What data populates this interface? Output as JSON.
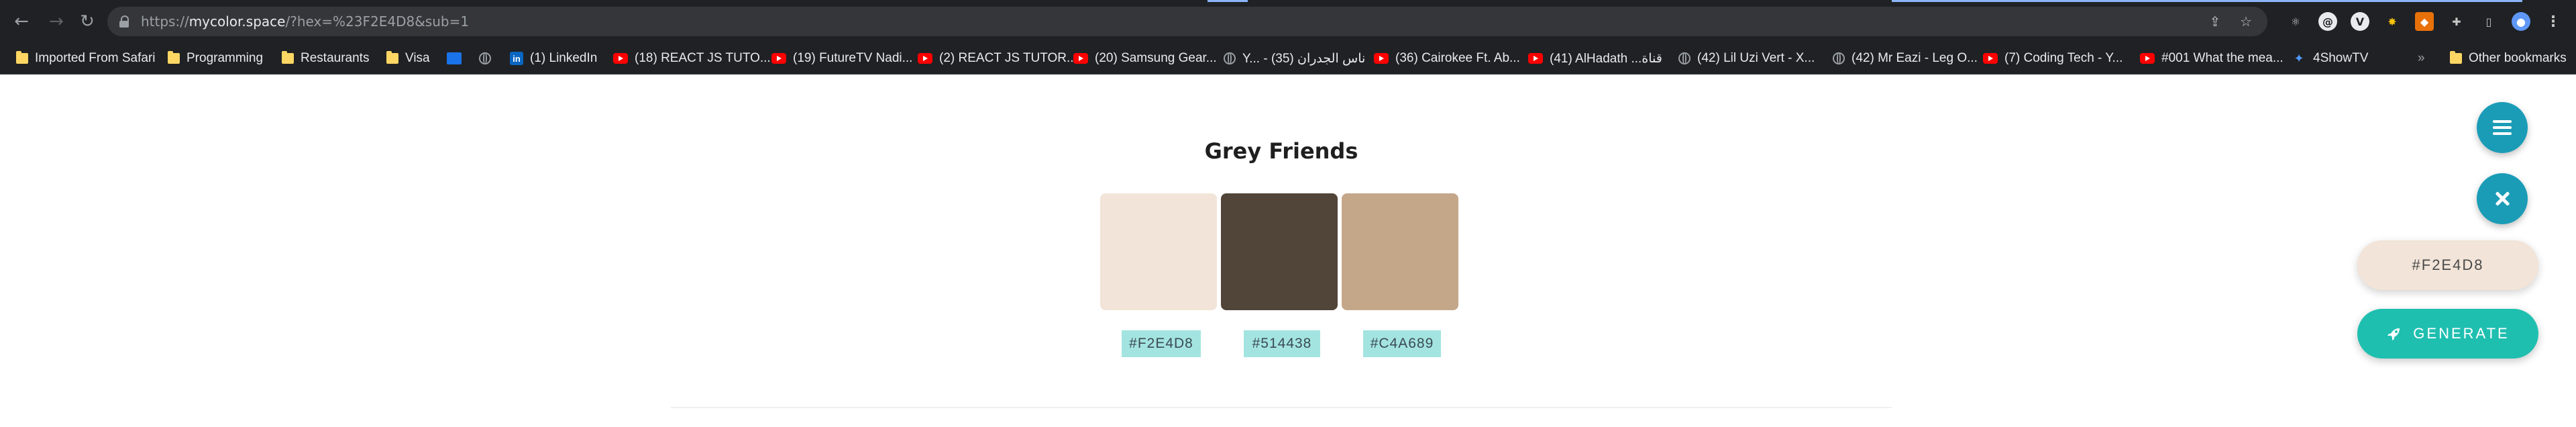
{
  "browser": {
    "url_prefix": "https://",
    "url_domain": "mycolor.space",
    "url_path": "/?hex=%23F2E4D8&sub=1",
    "bookmarks": [
      {
        "label": "Imported From Safari",
        "icon": "folder-icon"
      },
      {
        "label": "Programming",
        "icon": "folder-icon"
      },
      {
        "label": "Restaurants",
        "icon": "folder-icon"
      },
      {
        "label": "Visa",
        "icon": "folder-icon"
      },
      {
        "label": "",
        "icon": "book-icon"
      },
      {
        "label": "",
        "icon": "globe-icon"
      },
      {
        "label": "(1) LinkedIn",
        "icon": "linkedin-icon"
      },
      {
        "label": "(18) REACT JS TUTO...",
        "icon": "youtube-icon"
      },
      {
        "label": "(19) FutureTV Nadi...",
        "icon": "youtube-icon"
      },
      {
        "label": "(2) REACT JS TUTOR...",
        "icon": "youtube-icon"
      },
      {
        "label": "(20) Samsung Gear...",
        "icon": "youtube-icon"
      },
      {
        "label": "Y... - ناس الجدران (35)",
        "icon": "globe-icon"
      },
      {
        "label": "(36) Cairokee Ft. Ab...",
        "icon": "youtube-icon"
      },
      {
        "label": "(41) AlHadath ...قناة",
        "icon": "youtube-icon"
      },
      {
        "label": "(42) Lil Uzi Vert - X...",
        "icon": "globe-icon"
      },
      {
        "label": "(42) Mr Eazi - Leg O...",
        "icon": "globe-icon"
      },
      {
        "label": "(7) Coding Tech - Y...",
        "icon": "youtube-icon"
      },
      {
        "label": "#001 What the mea...",
        "icon": "youtube-icon"
      },
      {
        "label": "4ShowTV",
        "icon": "4showtv-icon"
      }
    ],
    "overflow_label": "»",
    "other_bookmarks": "Other bookmarks"
  },
  "page": {
    "title": "Grey Friends",
    "palette": [
      {
        "hex": "#F2E4D8",
        "color": "#F2E4D8"
      },
      {
        "hex": "#514438",
        "color": "#514438"
      },
      {
        "hex": "#C4A689",
        "color": "#C4A689"
      }
    ]
  },
  "controls": {
    "current_color": "#F2E4D8",
    "current_color_bg": "#F2E4D8",
    "generate_label": "GENERATE",
    "generate_bg": "#1fbfb0",
    "fab_color": "#1a9cb7"
  }
}
